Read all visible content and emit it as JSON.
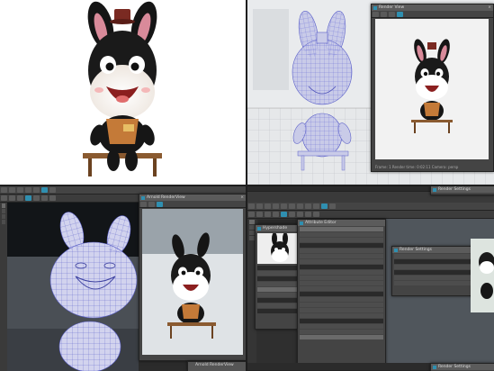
{
  "quadrants": {
    "top_right": {
      "render_view": {
        "title": "Render View",
        "status_text": "Frame: 1  Render time: 0:02:11  Camera: persp"
      }
    },
    "bottom_left": {
      "render_view": {
        "title": "Arnold RenderView"
      },
      "status_text": "Arnold RenderView"
    },
    "bottom_right": {
      "dialog_top": {
        "title": "Render Settings"
      },
      "hypershade": {
        "title": "Hypershade"
      },
      "attr_editor": {
        "title": "Attribute Editor"
      },
      "render_settings": {
        "title": "Render Settings"
      },
      "status_text": "Render Settings"
    }
  },
  "colors": {
    "maya_dark": "#444444",
    "maya_accent": "#2f8fb0",
    "wire_blue": "#6a6fd8",
    "mesh_fill": "#c9cbe8"
  }
}
